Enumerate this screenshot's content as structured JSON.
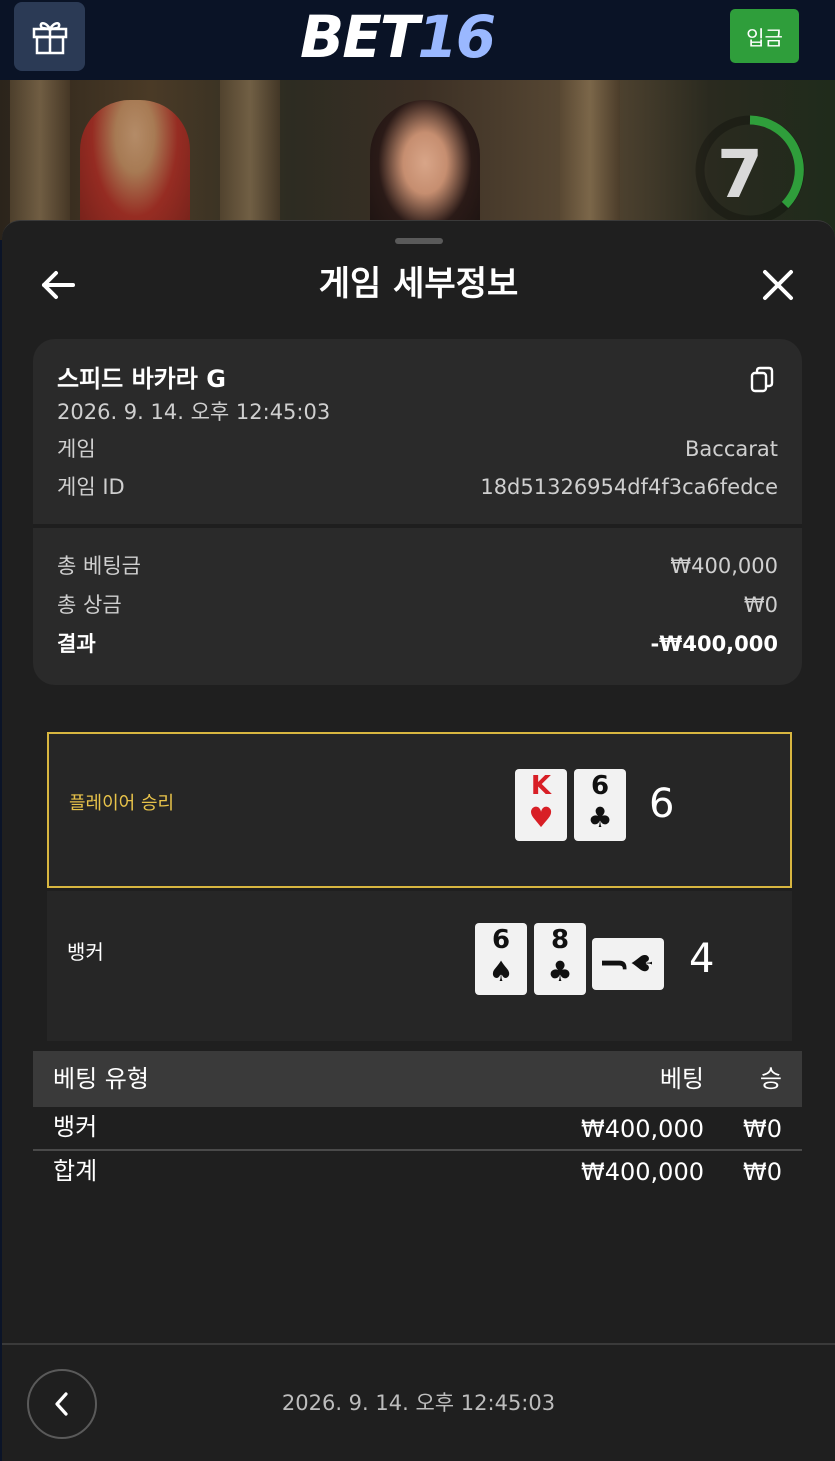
{
  "header": {
    "logo_part1": "BET",
    "logo_part2": "16",
    "deposit_label": "입금",
    "gift_icon": "gift-icon"
  },
  "video": {
    "countdown": "7",
    "timer_color": "#2f9e3b"
  },
  "sheet": {
    "title": "게임 세부정보",
    "back_icon": "arrow-left-icon",
    "close_icon": "close-icon"
  },
  "details": {
    "game_name": "스피드 바카라 G",
    "datetime": "2026. 9. 14. 오후 12:45:03",
    "rows": [
      {
        "label": "게임",
        "value": "Baccarat"
      },
      {
        "label": "게임 ID",
        "value": "18d51326954df4f3ca6fedce"
      }
    ],
    "totals": [
      {
        "label": "총 베팅금",
        "value": "₩400,000"
      },
      {
        "label": "총 상금",
        "value": "₩0"
      },
      {
        "label": "결과",
        "value": "-₩400,000"
      }
    ]
  },
  "results": {
    "player": {
      "label": "플레이어 승리",
      "score": "6",
      "cards": [
        {
          "rank": "K",
          "suit": "♥",
          "color": "red"
        },
        {
          "rank": "6",
          "suit": "♣",
          "color": "black"
        }
      ]
    },
    "banker": {
      "label": "뱅커",
      "score": "4",
      "cards": [
        {
          "rank": "6",
          "suit": "♠",
          "color": "black"
        },
        {
          "rank": "8",
          "suit": "♣",
          "color": "black"
        },
        {
          "rank": "J",
          "suit": "♠",
          "color": "black",
          "rotated": true
        }
      ]
    },
    "winner_border_color": "#d8b640"
  },
  "bets": {
    "headers": {
      "type": "베팅 유형",
      "bet": "베팅",
      "win": "승"
    },
    "rows": [
      {
        "type": "뱅커",
        "bet": "₩400,000",
        "win": "₩0"
      }
    ],
    "total": {
      "type": "합계",
      "bet": "₩400,000",
      "win": "₩0"
    }
  },
  "footer": {
    "datetime": "2026. 9. 14. 오후 12:45:03",
    "back_icon": "chevron-left-icon"
  }
}
